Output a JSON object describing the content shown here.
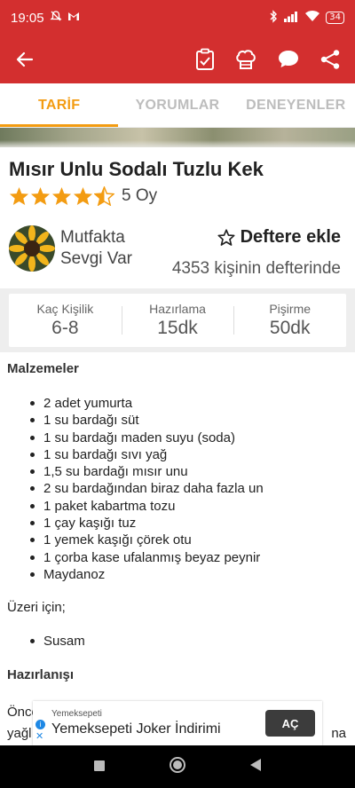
{
  "status": {
    "time": "19:05",
    "battery": "34",
    "icons": [
      "mute-icon",
      "gmail-icon",
      "bluetooth-icon",
      "signal-icon",
      "wifi-icon",
      "battery-icon"
    ]
  },
  "appbar": {
    "icons": [
      "back-arrow-icon",
      "clipboard-icon",
      "chef-hat-icon",
      "comment-icon",
      "share-icon"
    ],
    "color": "#d32f2f"
  },
  "tabs": [
    {
      "label": "TARİF",
      "active": true
    },
    {
      "label": "YORUMLAR",
      "active": false
    },
    {
      "label": "DENEYENLER",
      "active": false
    }
  ],
  "recipe": {
    "title": "Mısır Unlu Sodalı Tuzlu Kek",
    "stars": 4.5,
    "rating_label": "5 Oy",
    "author_line1": "Mutfakta",
    "author_line2": "Sevgi Var",
    "favorite_label": "Deftere ekle",
    "favorite_count": "4353 kişinin defterinde"
  },
  "info": [
    {
      "label": "Kaç Kişilik",
      "value": "6-8"
    },
    {
      "label": "Hazırlama",
      "value": "15dk"
    },
    {
      "label": "Pişirme",
      "value": "50dk"
    }
  ],
  "sections": {
    "ingredients_title": "Malzemeler",
    "ingredients": [
      "2 adet yumurta",
      "1 su bardağı süt",
      "1 su bardağı maden suyu (soda)",
      "1 su bardağı sıvı yağ",
      "1,5 su bardağı mısır unu",
      "2 su bardağından biraz daha fazla un",
      "1 paket kabartma tozu",
      "1 çay kaşığı tuz",
      "1 yemek kaşığı çörek otu",
      "1 çorba kase ufalanmış beyaz peynir",
      "Maydanoz"
    ],
    "topping_label": "Üzeri için;",
    "topping": [
      "Susam"
    ],
    "preparation_title": "Hazırlanışı",
    "prep_partial_1": "Önce",
    "prep_partial_2": "yağl",
    "prep_partial_right": "na"
  },
  "ad": {
    "brand": "Yemeksepeti",
    "title": "Yemeksepeti Joker İndirimi",
    "button": "AÇ"
  },
  "colors": {
    "primary": "#d32f2f",
    "accent": "#f39c12",
    "star": "#f39c12"
  }
}
